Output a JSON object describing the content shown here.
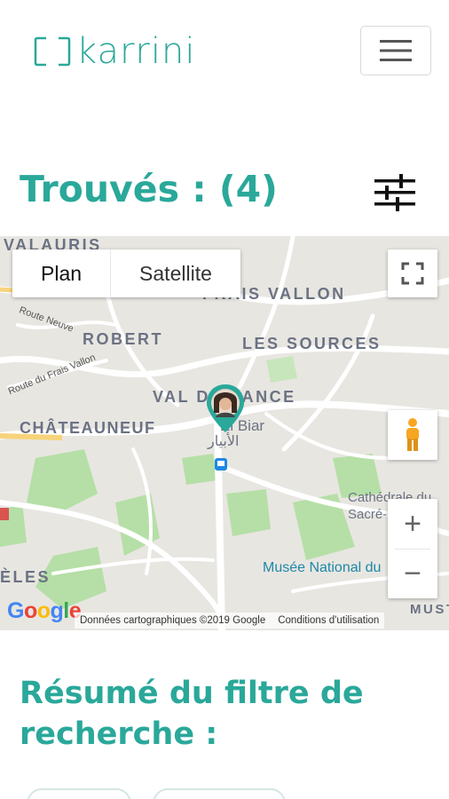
{
  "brand": {
    "name": "karrini",
    "color": "#2aa89a"
  },
  "header": {
    "menu_icon": "hamburger-icon"
  },
  "results": {
    "title": "Trouvés : (4)",
    "filter_icon": "sliders-icon"
  },
  "map": {
    "type_buttons": [
      "Plan",
      "Satellite"
    ],
    "fullscreen_icon": "fullscreen-icon",
    "pegman_icon": "pegman-icon",
    "zoom_in": "+",
    "zoom_out": "−",
    "districts": [
      "VALAURIS",
      "FRAIS VALLON",
      "ROBERT",
      "LES SOURCES",
      "VAL D'FRANCE",
      "CHÂTEAUNEUF",
      "ÈLES",
      "MUST"
    ],
    "streets": [
      "Route Neuve",
      "Route du Frais Vallon"
    ],
    "places": [
      "El Biar",
      "الأبيار",
      "Cathédrale du Sacré-Cœur",
      "Musée National du"
    ],
    "google_logo": "Google",
    "attribution": "Données cartographiques ©2019 Google",
    "terms": "Conditions d'utilisation",
    "marker_icon": "user-location-marker"
  },
  "summary": {
    "title": "Résumé du filtre de recherche :"
  }
}
